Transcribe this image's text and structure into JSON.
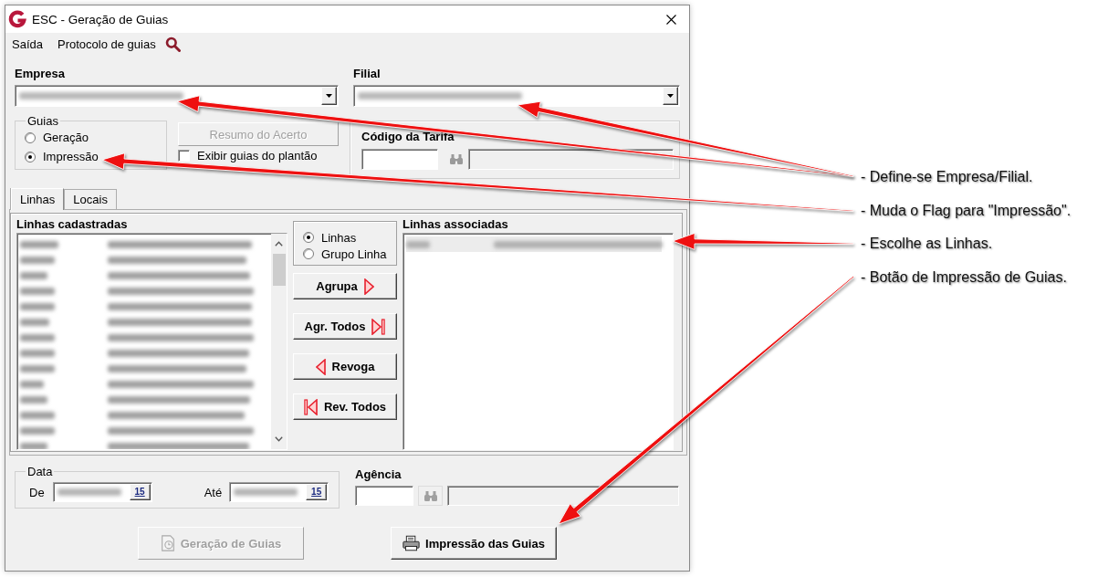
{
  "window": {
    "title": "ESC - Geração de Guias"
  },
  "menu": {
    "items": [
      "Saída",
      "Protocolo de guias"
    ]
  },
  "empresa": {
    "label": "Empresa"
  },
  "filial": {
    "label": "Filial"
  },
  "guias": {
    "legend": "Guias",
    "options": [
      {
        "label": "Geração",
        "selected": false
      },
      {
        "label": "Impressão",
        "selected": true
      }
    ]
  },
  "resumo_button": {
    "label": "Resumo do Acerto",
    "disabled": true
  },
  "exibir": {
    "label": "Exibir guias do plantão",
    "checked": false
  },
  "tarifa": {
    "label": "Código da Tarifa"
  },
  "tabs": [
    {
      "label": "Linhas",
      "selected": true
    },
    {
      "label": "Locais",
      "selected": false
    }
  ],
  "linhas_cadastradas": {
    "title": "Linhas cadastradas"
  },
  "mode": {
    "options": [
      {
        "label": "Linhas",
        "selected": true
      },
      {
        "label": "Grupo Linha",
        "selected": false
      }
    ]
  },
  "actions": [
    {
      "label": "Agrupa",
      "kind": "add"
    },
    {
      "label": "Agr. Todos",
      "kind": "add_all"
    },
    {
      "label": "Revoga",
      "kind": "remove"
    },
    {
      "label": "Rev. Todos",
      "kind": "remove_all"
    }
  ],
  "linhas_associadas": {
    "title": "Linhas associadas"
  },
  "data": {
    "legend": "Data",
    "from": {
      "label": "De",
      "calendar": "15"
    },
    "to": {
      "label": "Até",
      "calendar": "15"
    }
  },
  "agencia": {
    "label": "Agência"
  },
  "buttons": [
    {
      "label": "Geração de Guias",
      "kind": "generate",
      "disabled": true
    },
    {
      "label": "Impressão das Guias",
      "kind": "print",
      "disabled": false
    }
  ],
  "annotations": [
    "- Define-se Empresa/Filial.",
    "- Muda o Flag para \"Impressão\".",
    "- Escolhe as Linhas.",
    "- Botão de Impressão de Guias."
  ]
}
